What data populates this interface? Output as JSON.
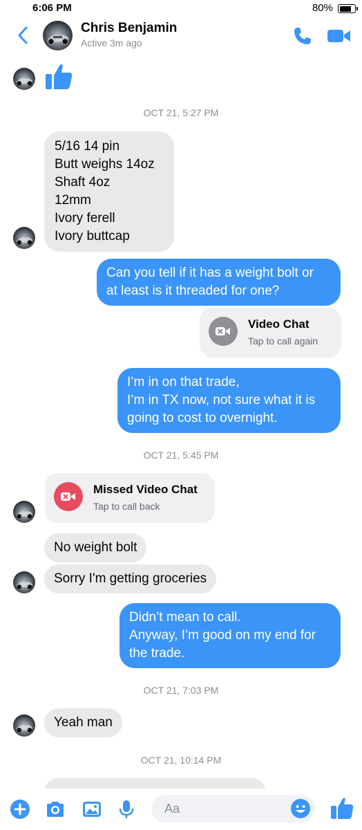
{
  "status_bar": {
    "time": "6:06 PM",
    "battery_text": "80%",
    "battery_level": 0.8
  },
  "header": {
    "contact_name": "Chris Benjamin",
    "status": "Active 3m ago",
    "back_icon": "chevron-left-icon",
    "call_icon": "phone-icon",
    "video_icon": "video-camera-icon"
  },
  "accent_color": "#3b94f7",
  "messages": {
    "timestamps": [
      "OCT 21, 5:27 PM",
      "OCT 21, 5:45 PM",
      "OCT 21, 7:03 PM",
      "OCT 21, 10:14 PM"
    ],
    "m1_lines": "5/16 14 pin\nButt weighs 14oz\nShaft 4oz\n12mm\nIvory ferell\nIvory buttcap",
    "m2": "Can you tell if it has a weight bolt or\nat least is it threaded for one?",
    "video_chat": {
      "title": "Video Chat",
      "subtitle": "Tap to call again"
    },
    "m3": "I’m in on that trade,\nI’m in TX now, not sure what it is\ngoing to cost to overnight.",
    "missed_video_chat": {
      "title": "Missed Video Chat",
      "subtitle": "Tap to call back"
    },
    "m4": "No weight bolt",
    "m5": "Sorry I'm getting groceries",
    "m6": "Didn’t mean to call.\nAnyway, I’m good on my end for\nthe trade.",
    "m7": "Yeah man"
  },
  "composer": {
    "placeholder": "Aa",
    "icons": [
      "plus-icon",
      "camera-icon",
      "image-icon",
      "microphone-icon",
      "emoji-icon",
      "thumbs-up-icon"
    ]
  }
}
